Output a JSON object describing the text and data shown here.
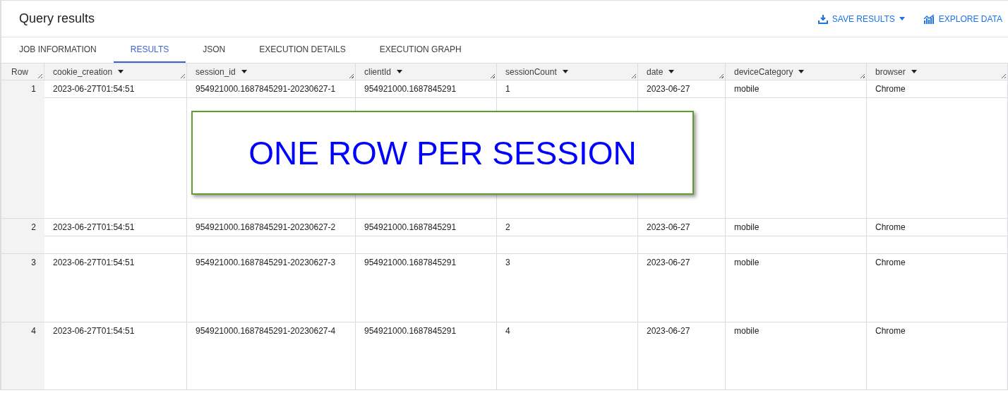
{
  "title": "Query results",
  "actions": [
    {
      "kind": "save",
      "label": "SAVE RESULTS",
      "dropdown": true
    },
    {
      "kind": "explore",
      "label": "EXPLORE DATA",
      "dropdown": false
    }
  ],
  "tabs": [
    {
      "label": "JOB INFORMATION",
      "selected": false
    },
    {
      "label": "RESULTS",
      "selected": true
    },
    {
      "label": "JSON",
      "selected": false
    },
    {
      "label": "EXECUTION DETAILS",
      "selected": false
    },
    {
      "label": "EXECUTION GRAPH",
      "selected": false
    }
  ],
  "table": {
    "row_header": "Row",
    "columns": [
      "cookie_creation",
      "session_id",
      "clientId",
      "sessionCount",
      "date",
      "deviceCategory",
      "browser"
    ],
    "rows": [
      {
        "row": "1",
        "cells": [
          "2023-06-27T01:54:51",
          "954921000.1687845291-20230627-1",
          "954921000.1687845291",
          "1",
          "2023-06-27",
          "mobile",
          "Chrome"
        ]
      },
      {
        "row": "2",
        "cells": [
          "2023-06-27T01:54:51",
          "954921000.1687845291-20230627-2",
          "954921000.1687845291",
          "2",
          "2023-06-27",
          "mobile",
          "Chrome"
        ]
      },
      {
        "row": "3",
        "cells": [
          "2023-06-27T01:54:51",
          "954921000.1687845291-20230627-3",
          "954921000.1687845291",
          "3",
          "2023-06-27",
          "mobile",
          "Chrome"
        ]
      },
      {
        "row": "4",
        "cells": [
          "2023-06-27T01:54:51",
          "954921000.1687845291-20230627-4",
          "954921000.1687845291",
          "4",
          "2023-06-27",
          "mobile",
          "Chrome"
        ]
      }
    ]
  },
  "callout": "ONE ROW PER SESSION"
}
